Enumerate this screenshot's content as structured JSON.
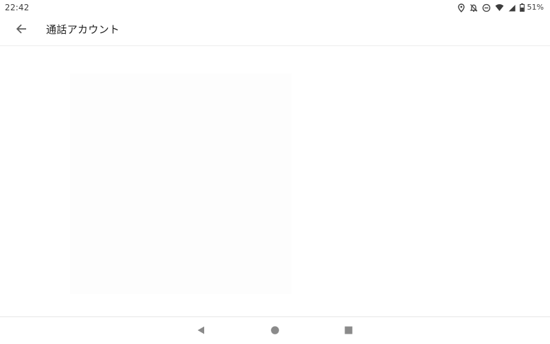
{
  "status_bar": {
    "time": "22:42",
    "battery_percent": "51%",
    "icons": [
      "location-icon",
      "notifications-off-icon",
      "do-not-disturb-icon",
      "wifi-icon",
      "cell-signal-icon",
      "battery-icon"
    ]
  },
  "app_bar": {
    "title": "通話アカウント",
    "back_icon": "arrow-back-icon"
  },
  "nav_bar": {
    "icons": [
      "triangle-back-icon",
      "circle-home-icon",
      "square-recents-icon"
    ]
  },
  "colors": {
    "icon": "#5f5f5f",
    "text": "#202020",
    "nav_icon": "#8a8a8a",
    "divider": "#ececec"
  }
}
